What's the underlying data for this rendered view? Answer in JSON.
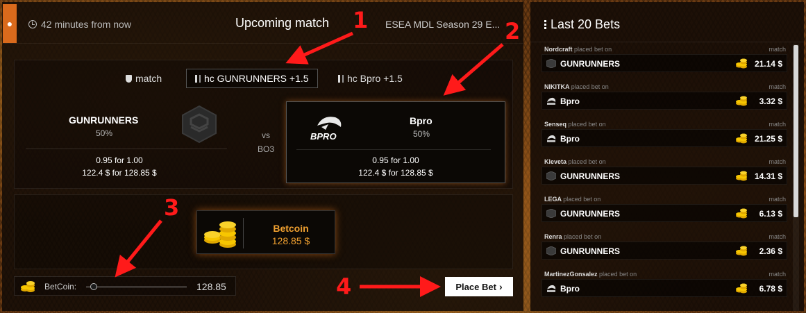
{
  "header": {
    "time": "42 minutes from now",
    "title": "Upcoming match",
    "tournament": "ESEA MDL Season 29 E..."
  },
  "tabs": [
    {
      "label": "match"
    },
    {
      "label": "hc GUNRUNNERS +1.5"
    },
    {
      "label": "hc Bpro +1.5"
    }
  ],
  "match": {
    "team1": {
      "name": "GUNRUNNERS",
      "percent": "50%",
      "odds": "0.95 for 1.00",
      "return": "122.4 $ for 128.85 $"
    },
    "team2": {
      "name": "Bpro",
      "percent": "50%",
      "odds": "0.95 for 1.00",
      "return": "122.4 $ for 128.85 $"
    },
    "vs": "vs",
    "format": "BO3",
    "team2_logo_text": "BPRO"
  },
  "betcoin": {
    "label": "Betcoin",
    "value": "128.85 $",
    "slider_label": "BetCoin:",
    "slider_value": "128.85",
    "slider_level": 0.05
  },
  "place_bet": {
    "label": "Place Bet"
  },
  "annotations": [
    "1",
    "2",
    "3",
    "4"
  ],
  "last_bets": {
    "title": "Last 20 Bets",
    "placed_text": "placed bet on",
    "items": [
      {
        "user": "Nordcraft",
        "kind": "match",
        "team": "GUNRUNNERS",
        "amount": "21.14 $"
      },
      {
        "user": "NIKITKA",
        "kind": "match",
        "team": "Bpro",
        "amount": "3.32 $"
      },
      {
        "user": "Senseq",
        "kind": "match",
        "team": "Bpro",
        "amount": "21.25 $"
      },
      {
        "user": "Kleveta",
        "kind": "match",
        "team": "GUNRUNNERS",
        "amount": "14.31 $"
      },
      {
        "user": "LEGA",
        "kind": "match",
        "team": "GUNRUNNERS",
        "amount": "6.13 $"
      },
      {
        "user": "Renra",
        "kind": "match",
        "team": "GUNRUNNERS",
        "amount": "2.36 $"
      },
      {
        "user": "MartinezGonsalez",
        "kind": "match",
        "team": "Bpro",
        "amount": "6.78 $"
      }
    ]
  },
  "colors": {
    "accent": "#f0a030",
    "annotation": "#ff1a1a",
    "game_badge": "#d96a1c"
  }
}
